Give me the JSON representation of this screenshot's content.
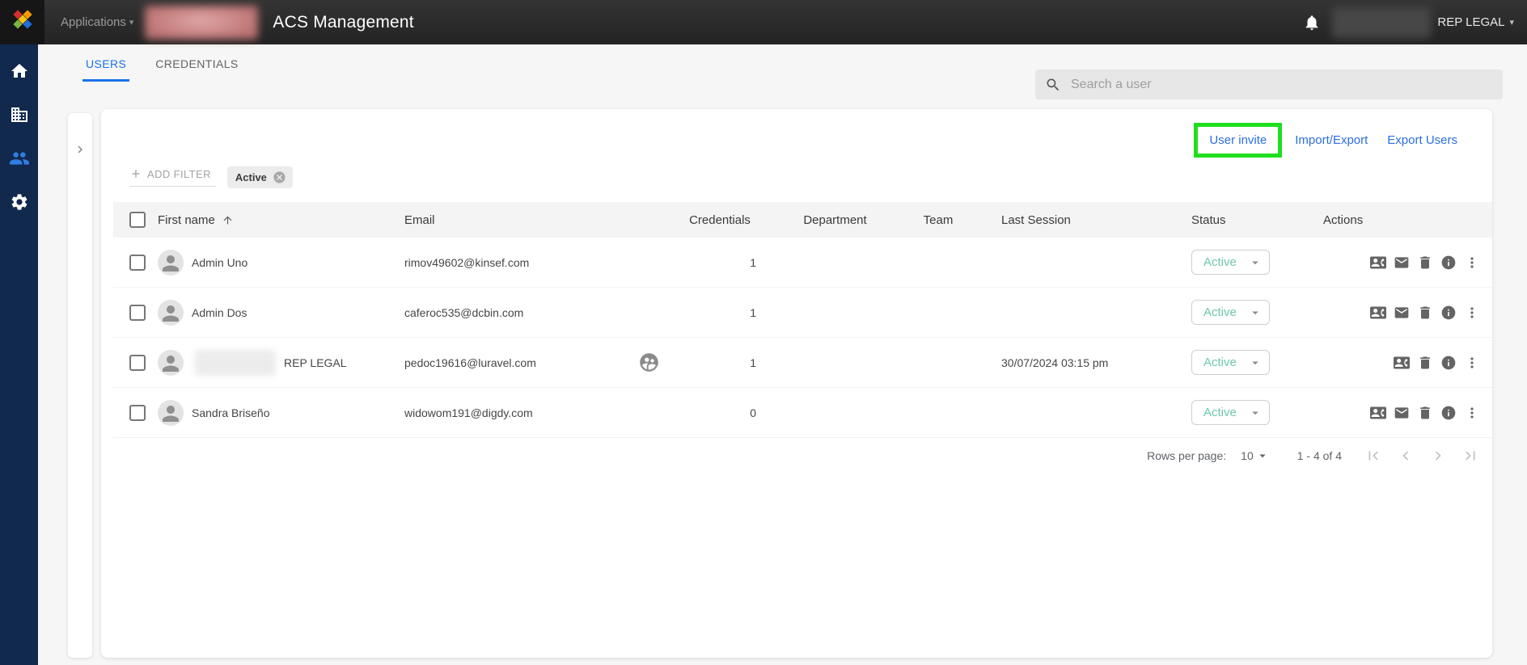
{
  "topbar": {
    "applications_label": "Applications",
    "app_title": "ACS Management",
    "account_label": "REP LEGAL"
  },
  "sidebar": {
    "items": [
      {
        "name": "home",
        "active": false
      },
      {
        "name": "organization",
        "active": false
      },
      {
        "name": "users",
        "active": true
      },
      {
        "name": "settings",
        "active": false
      }
    ]
  },
  "tabs": {
    "users": "USERS",
    "credentials": "CREDENTIALS",
    "active_tab": "USERS"
  },
  "search": {
    "placeholder": "Search a user"
  },
  "toolbar": {
    "user_invite": "User invite",
    "import_export": "Import/Export",
    "export_users": "Export Users",
    "highlight_color": "#1fdf1f"
  },
  "filter": {
    "add_filter": "ADD FILTER",
    "active_chip": "Active"
  },
  "table": {
    "headers": {
      "first_name": "First name",
      "email": "Email",
      "credentials": "Credentials",
      "department": "Department",
      "team": "Team",
      "last_session": "Last Session",
      "status": "Status",
      "actions": "Actions"
    },
    "sorted_by": "First name",
    "rows": [
      {
        "name": "Admin Uno",
        "name_redacted": false,
        "email": "rimov49602@kinsef.com",
        "badge": false,
        "credentials": "1",
        "department": "",
        "team": "",
        "last_session": "",
        "status": "Active",
        "actions": [
          "contact-card",
          "mail",
          "delete",
          "info",
          "more"
        ]
      },
      {
        "name": "Admin Dos",
        "name_redacted": false,
        "email": "caferoc535@dcbin.com",
        "badge": false,
        "credentials": "1",
        "department": "",
        "team": "",
        "last_session": "",
        "status": "Active",
        "actions": [
          "contact-card",
          "mail",
          "delete",
          "info",
          "more"
        ]
      },
      {
        "name": "REP LEGAL",
        "name_redacted": true,
        "email": "pedoc19616@luravel.com",
        "badge": true,
        "credentials": "1",
        "department": "",
        "team": "",
        "last_session": "30/07/2024 03:15 pm",
        "status": "Active",
        "actions": [
          "contact-card",
          "delete",
          "info",
          "more"
        ]
      },
      {
        "name": "Sandra Briseño",
        "name_redacted": false,
        "email": "widowom191@digdy.com",
        "badge": false,
        "credentials": "0",
        "department": "",
        "team": "",
        "last_session": "",
        "status": "Active",
        "actions": [
          "contact-card",
          "mail",
          "delete",
          "info",
          "more"
        ]
      }
    ]
  },
  "pagination": {
    "rows_per_page_label": "Rows per page:",
    "rows_per_page_value": "10",
    "range": "1 - 4 of 4"
  },
  "colors": {
    "accent_blue": "#1a73e8",
    "link_blue": "#2b6fdd",
    "highlight_green": "#1fdf1f",
    "status_teal": "#6fc8ab",
    "sidebar_navy": "#10294d"
  }
}
